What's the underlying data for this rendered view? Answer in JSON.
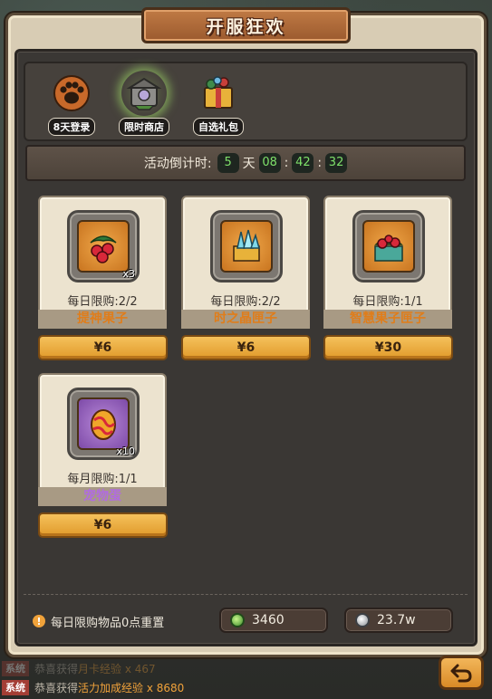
{
  "title": "开服狂欢",
  "tabs": [
    {
      "label": "8天登录",
      "icon": "paw-icon",
      "active": false
    },
    {
      "label": "限时商店",
      "icon": "shop-icon",
      "active": true
    },
    {
      "label": "自选礼包",
      "icon": "gift-box-icon",
      "active": false
    }
  ],
  "countdown": {
    "label": "活动倒计时:",
    "days": "5",
    "day_unit": "天",
    "hours": "08",
    "minutes": "42",
    "seconds": "32",
    "separator": ":"
  },
  "items": [
    {
      "name": "提神果子",
      "limit": "每日限购:2/2",
      "qty": "x3",
      "price": "¥6",
      "icon": "berry-icon",
      "name_color": "#e07d1a"
    },
    {
      "name": "时之晶匣子",
      "limit": "每日限购:2/2",
      "qty": "",
      "price": "¥6",
      "icon": "crystal-box-icon",
      "name_color": "#e07d1a"
    },
    {
      "name": "智慧果子匣子",
      "limit": "每日限购:1/1",
      "qty": "",
      "price": "¥30",
      "icon": "fruit-box-icon",
      "name_color": "#e07d1a"
    },
    {
      "name": "宠物蛋",
      "limit": "每月限购:1/1",
      "qty": "x10",
      "price": "¥6",
      "icon": "pet-egg-icon",
      "name_color": "#b16be0"
    }
  ],
  "footer": {
    "notice": "每日限购物品0点重置",
    "gems": "3460",
    "coins": "23.7w"
  },
  "chat": [
    {
      "tag": "系统",
      "text": "恭喜获得",
      "item": "月卡经验 x 467"
    },
    {
      "tag": "系统",
      "text": "恭喜获得",
      "item": "活力加成经验 x 8680"
    }
  ],
  "colors": {
    "accent_gold": "#e09a2a",
    "countdown_green": "#7ee06a",
    "name_orange": "#e07d1a",
    "name_purple": "#b16be0"
  }
}
